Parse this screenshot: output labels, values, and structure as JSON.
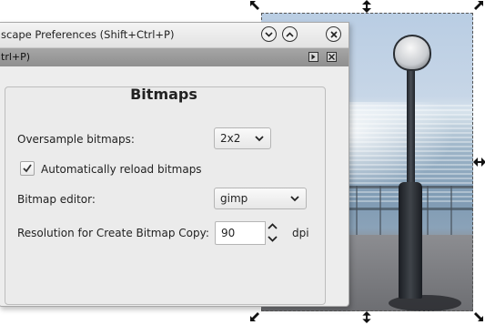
{
  "window": {
    "title": "scape Preferences (Shift+Ctrl+P)",
    "subtitle": "trl+P)"
  },
  "panel": {
    "heading": "Bitmaps",
    "oversample": {
      "label": "Oversample bitmaps:",
      "value": "2x2"
    },
    "autoreload": {
      "label": "Automatically reload bitmaps",
      "checked": true
    },
    "editor": {
      "label": "Bitmap editor:",
      "value": "gimp"
    },
    "resolution": {
      "label": "Resolution for Create Bitmap Copy:",
      "value": "90",
      "unit": "dpi"
    }
  },
  "icons": {
    "titlebar": [
      "chevron-down-icon",
      "chevron-up-icon",
      "close-icon"
    ],
    "subbar": [
      "dock-icon",
      "close-icon"
    ],
    "handles": [
      "arrow-diagonal-nw-icon",
      "arrow-up-down-icon",
      "arrow-diagonal-ne-icon",
      "arrow-left-right-icon",
      "arrow-diagonal-sw-icon",
      "arrow-diagonal-se-icon"
    ]
  },
  "colors": {
    "dialog_bg": "#ededed",
    "subbar_bg": "#9a9a9a",
    "selection_border": "#555555"
  }
}
